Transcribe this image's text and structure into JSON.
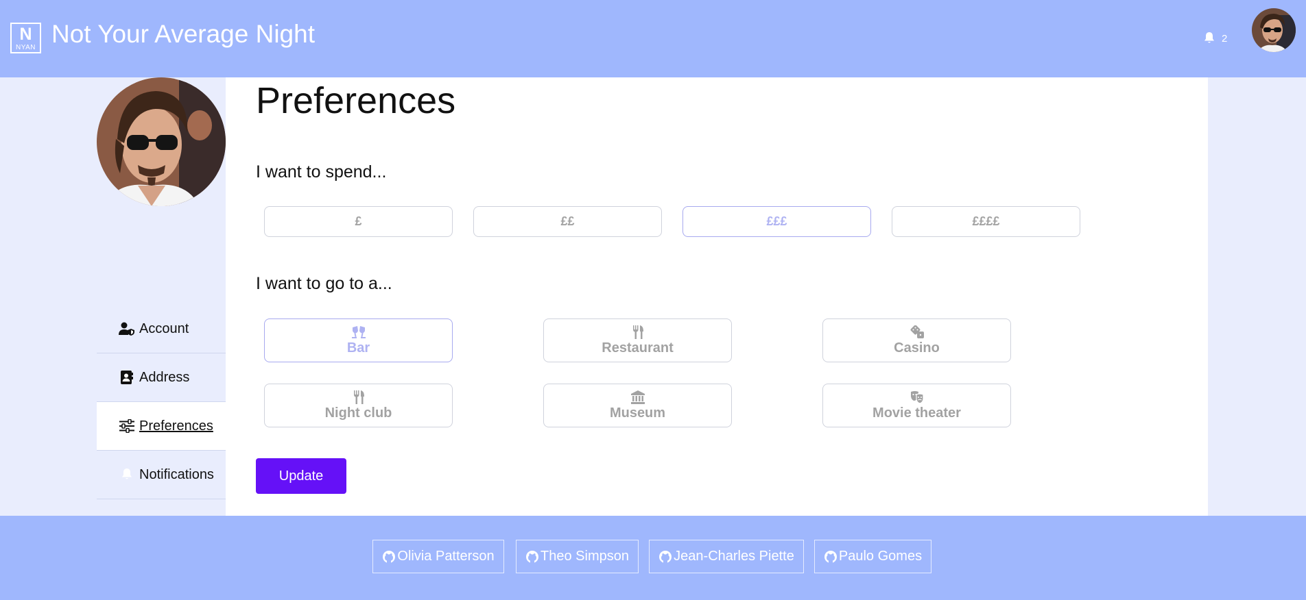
{
  "header": {
    "logo_big": "N",
    "logo_small": "NYAN",
    "title": "Not Your Average Night",
    "notification_count": "2"
  },
  "sidebar": {
    "items": [
      {
        "label": "Account",
        "icon": "user-shield-icon",
        "active": false
      },
      {
        "label": "Address",
        "icon": "address-book-icon",
        "active": false
      },
      {
        "label": "Preferences",
        "icon": "sliders-icon",
        "active": true
      },
      {
        "label": "Notifications",
        "icon": "bell-icon",
        "active": false
      }
    ]
  },
  "main": {
    "title": "Preferences",
    "spend_label": "I want to spend...",
    "price_options": [
      {
        "label": "£",
        "selected": false
      },
      {
        "label": "££",
        "selected": false
      },
      {
        "label": "£££",
        "selected": true
      },
      {
        "label": "££££",
        "selected": false
      }
    ],
    "venue_label": "I want to go to a...",
    "venue_options": [
      {
        "label": "Bar",
        "icon": "glass-cheers-icon",
        "selected": true
      },
      {
        "label": "Restaurant",
        "icon": "utensils-icon",
        "selected": false
      },
      {
        "label": "Casino",
        "icon": "dice-icon",
        "selected": false
      },
      {
        "label": "Night club",
        "icon": "utensils-icon",
        "selected": false
      },
      {
        "label": "Museum",
        "icon": "landmark-icon",
        "selected": false
      },
      {
        "label": "Movie theater",
        "icon": "theater-masks-icon",
        "selected": false
      }
    ],
    "update_label": "Update"
  },
  "footer": {
    "contributors": [
      "Olivia Patterson",
      "Theo Simpson",
      "Jean-Charles Piette",
      "Paulo Gomes"
    ]
  },
  "colors": {
    "header_bg": "#9fb7fd",
    "page_bg": "#e9edfd",
    "accent": "#6511f7",
    "selected_text": "#aeb2f2"
  }
}
